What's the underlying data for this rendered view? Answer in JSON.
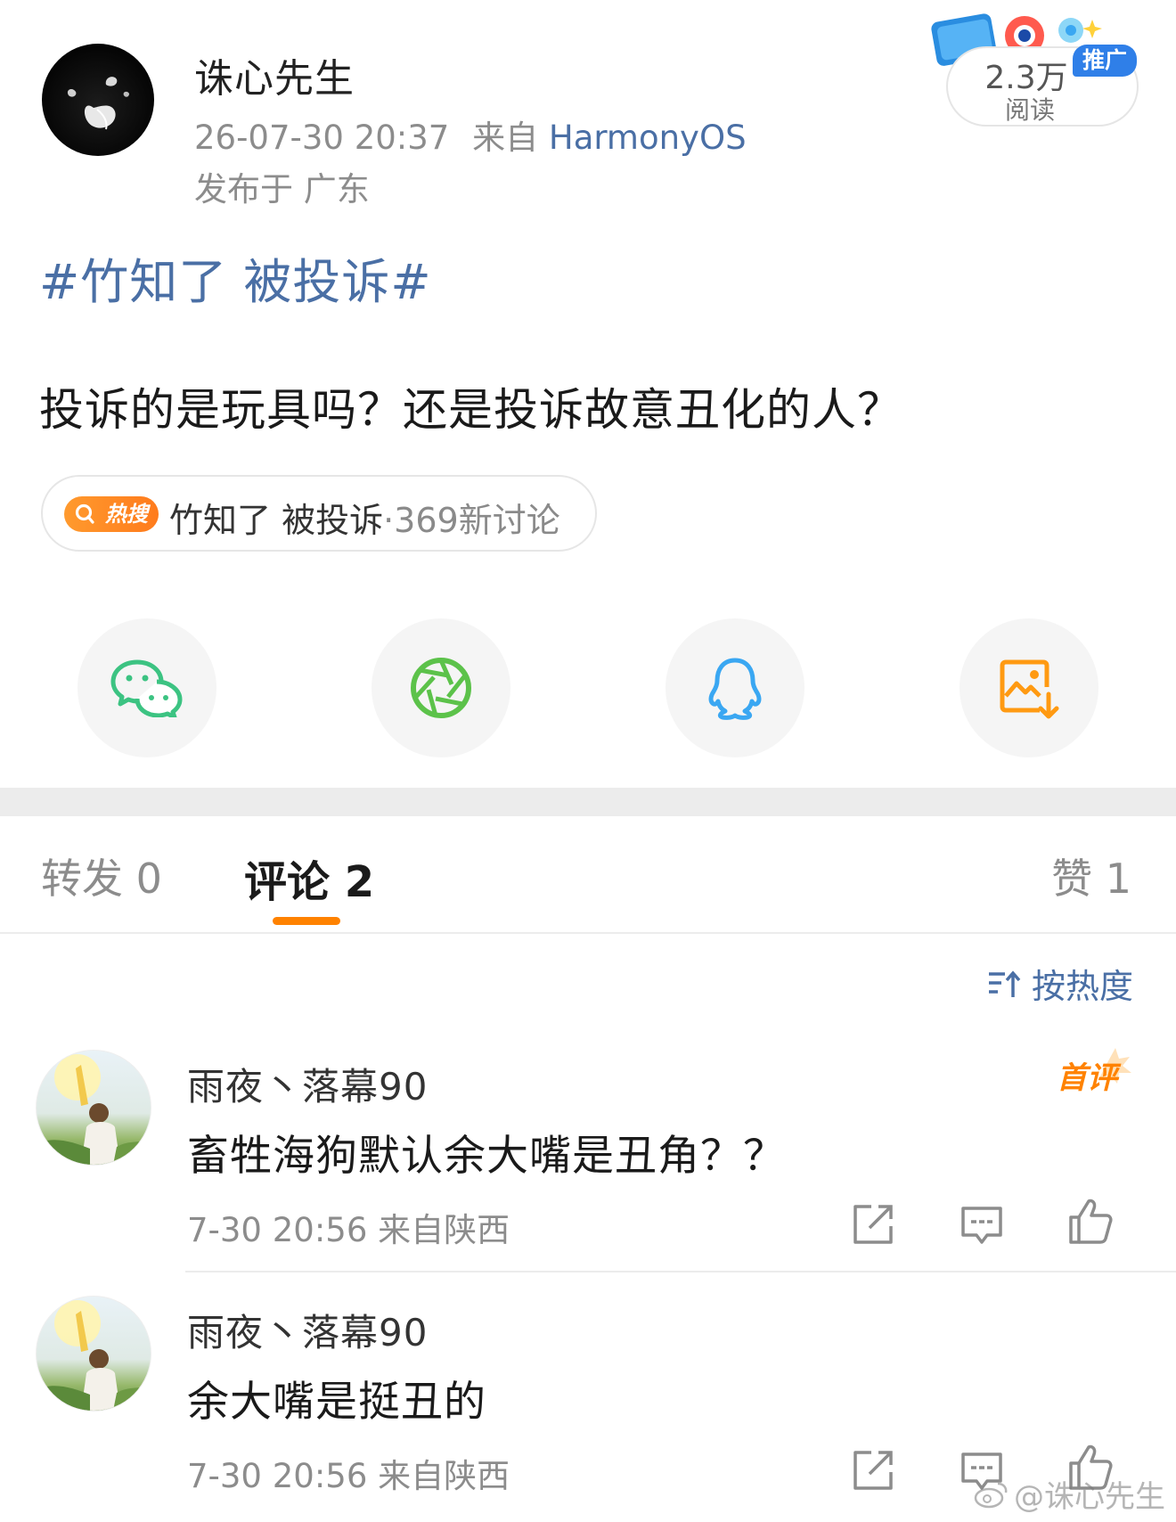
{
  "post": {
    "author": "诛心先生",
    "timestamp": "26-07-30 20:37",
    "source_prefix": "来自",
    "source": "HarmonyOS",
    "location": "发布于 广东",
    "topic_tag": "#竹知了 被投诉#",
    "text": "投诉的是玩具吗？还是投诉故意丑化的人？"
  },
  "reads": {
    "count": "2.3万",
    "label": "阅读",
    "promo": "推广"
  },
  "hot_search": {
    "badge": "热搜",
    "topic": "竹知了 被投诉",
    "count": "·369新讨论"
  },
  "share": {
    "icons": [
      "wechat-icon",
      "moments-icon",
      "qq-icon",
      "save-image-icon"
    ],
    "colors": {
      "wechat": "#3cc382",
      "moments": "#5cc24a",
      "qq": "#3aa7f2",
      "save": "#ff9a12"
    }
  },
  "tabs": {
    "repost": "转发 0",
    "comment": "评论 2",
    "like": "赞 1",
    "active": "comment"
  },
  "sort": {
    "label": "按热度"
  },
  "comments": [
    {
      "name": "雨夜丶落幕90",
      "text": "畜牲海狗默认余大嘴是丑角？？",
      "meta": "7-30 20:56 来自陕西",
      "badge": "首评"
    },
    {
      "name": "雨夜丶落幕90",
      "text": "余大嘴是挺丑的",
      "meta": "7-30 20:56 来自陕西"
    }
  ],
  "watermark": "@诛心先生",
  "accent": {
    "link": "#4a6fa5",
    "orange": "#ff8200",
    "gray": "#8c8c8c"
  }
}
